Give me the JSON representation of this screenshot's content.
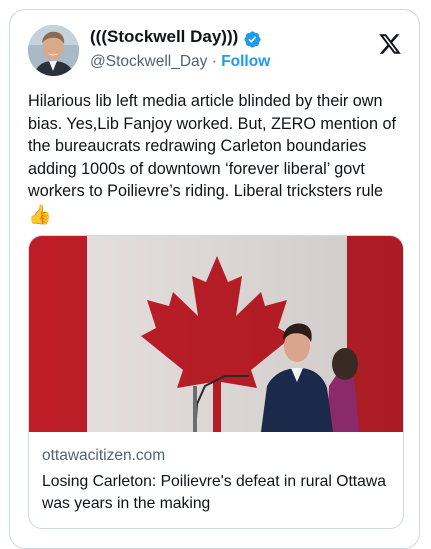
{
  "author": {
    "display_name": "(((Stockwell Day)))",
    "handle": "@Stockwell_Day",
    "separator": "·",
    "follow_label": "Follow"
  },
  "tweet": {
    "text": "Hilarious lib left media article blinded by their own bias. Yes,Lib Fanjoy worked. But, ZERO mention of the bureaucrats redrawing Carleton boundaries adding 1000s of downtown ‘forever liberal’ govt workers to Poilievre’s riding. Liberal tricksters rule",
    "emoji": "👍"
  },
  "link_card": {
    "domain": "ottawacitizen.com",
    "title": "Losing Carleton: Poilievre's defeat in rural Ottawa was years in the making"
  },
  "colors": {
    "accent": "#1d9bf0",
    "text": "#0f1419",
    "muted": "#536471",
    "border": "#cfd9de",
    "flag_red": "#c8202a"
  },
  "icons": {
    "verified": "verified-badge-icon",
    "platform": "x-logo-icon"
  }
}
